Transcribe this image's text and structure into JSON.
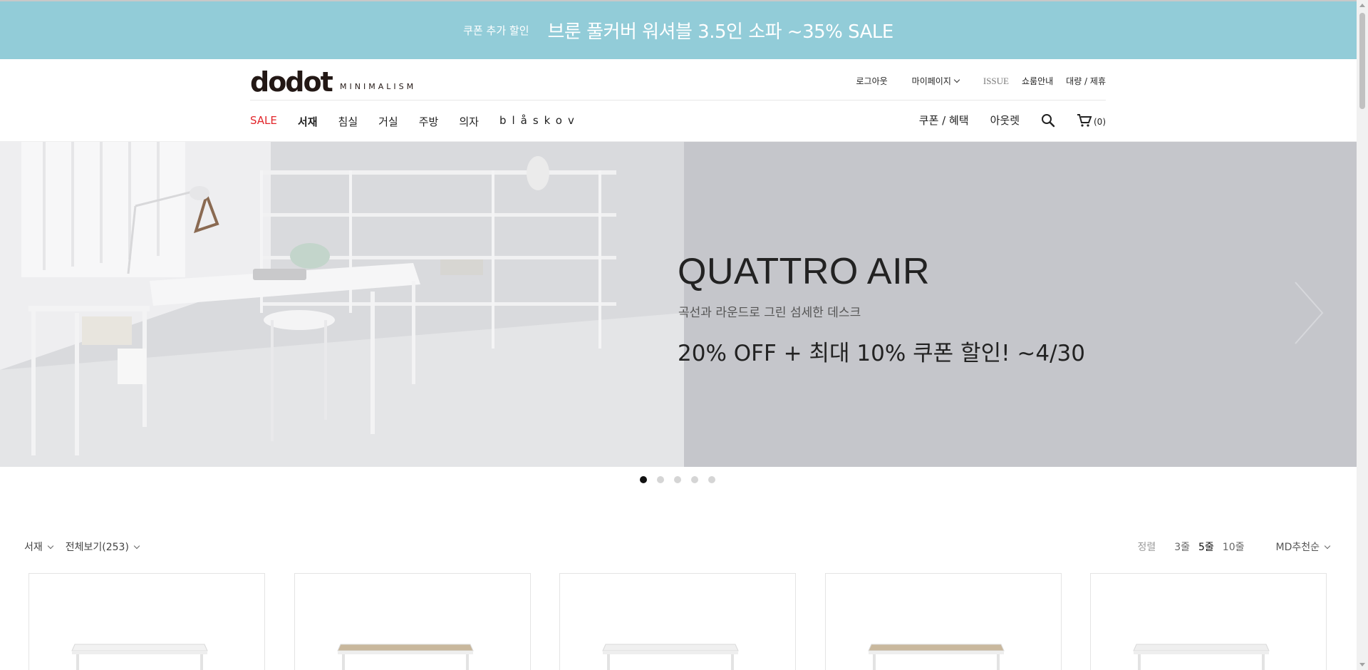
{
  "promo": {
    "coupon": "쿠폰 추가 할인",
    "headline": "브룬 풀커버 워셔블 3.5인 소파 ~35% SALE"
  },
  "header": {
    "logo": "dodot",
    "logo_sub": "MINIMALISM",
    "util": {
      "logout": "로그아웃",
      "mypage": "마이페이지",
      "issue": "ISSUE",
      "showroom": "쇼룸안내",
      "bulk": "대량 / 제휴"
    },
    "nav": [
      "SALE",
      "서재",
      "침실",
      "거실",
      "주방",
      "의자",
      "blåskov"
    ],
    "right_nav": {
      "coupon": "쿠폰 / 혜택",
      "outlet": "아웃렛",
      "cart_count": "(0)"
    }
  },
  "hero": {
    "title": "QUATTRO AIR",
    "subtitle": "곡선과 라운드로 그린 섬세한 데스크",
    "offer": "20% OFF + 최대 10% 쿠폰 할인! ~4/30"
  },
  "slider": {
    "count": 5,
    "active": 1
  },
  "filters": {
    "category": "서재",
    "view_all": "전체보기(253)",
    "sort_label": "정렬",
    "rows": [
      "3줄",
      "5줄",
      "10줄"
    ],
    "active_row": "5줄",
    "order": "MD추천순"
  },
  "products": [
    {
      "top_color": "#f2f2f2"
    },
    {
      "top_color": "#c8b79c"
    },
    {
      "top_color": "#f0f0f0"
    },
    {
      "top_color": "#c9b89d"
    },
    {
      "top_color": "#efefef"
    }
  ],
  "colors": {
    "promo_bg": "#92ccd8",
    "sale_red": "#e2262b",
    "hero_bg": "#c5c6cb"
  }
}
